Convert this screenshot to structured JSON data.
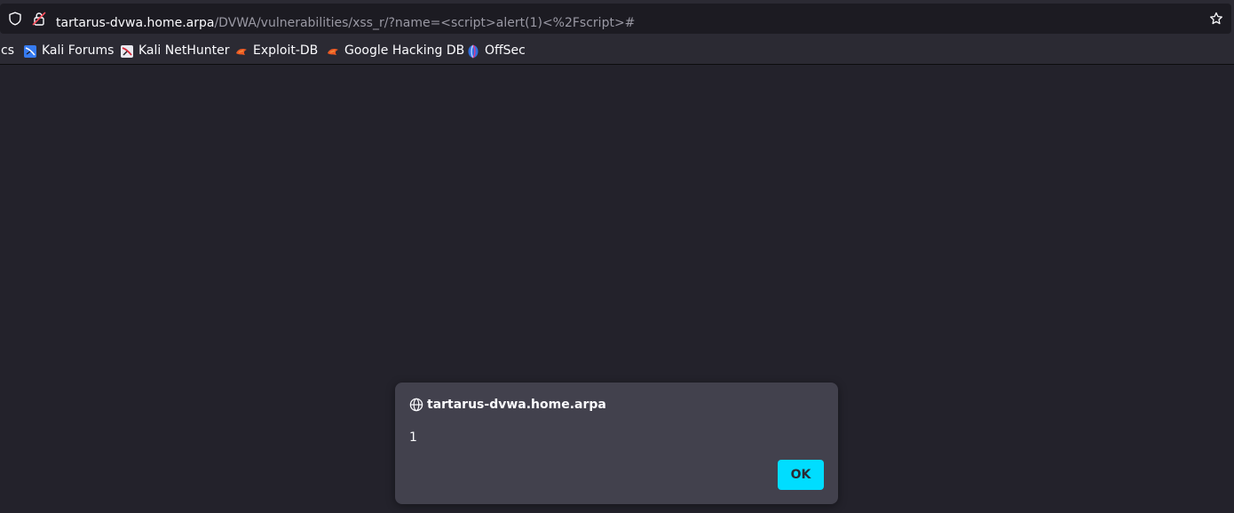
{
  "browser": {
    "url_host": "tartarus-dvwa.home.arpa",
    "url_path": "/DVWA/vulnerabilities/xss_r/?name=<script>alert(1)<%2Fscript>#",
    "icons": {
      "shield": "shield-icon",
      "insecure_lock": "insecure-lock-icon",
      "bookmark_star": "bookmark-star-icon"
    }
  },
  "bookmarks": {
    "partial_label": "cs",
    "items": [
      {
        "label": "Kali Forums",
        "icon": "kali-forums-icon"
      },
      {
        "label": "Kali NetHunter",
        "icon": "kali-nethunter-icon"
      },
      {
        "label": "Exploit-DB",
        "icon": "exploit-db-icon"
      },
      {
        "label": "Google Hacking DB",
        "icon": "google-hacking-db-icon"
      },
      {
        "label": "OffSec",
        "icon": "offsec-icon"
      }
    ]
  },
  "alert_dialog": {
    "origin": "tartarus-dvwa.home.arpa",
    "message": "1",
    "ok_label": "OK",
    "icon": "globe-icon"
  },
  "colors": {
    "toolbar_bg": "#2b2a33",
    "urlbar_bg": "#1c1b22",
    "page_bg": "#23222b",
    "dialog_bg": "#42414d",
    "ok_button": "#00ddff",
    "text": "#fbfbfe",
    "muted_text": "#9a99a4"
  }
}
